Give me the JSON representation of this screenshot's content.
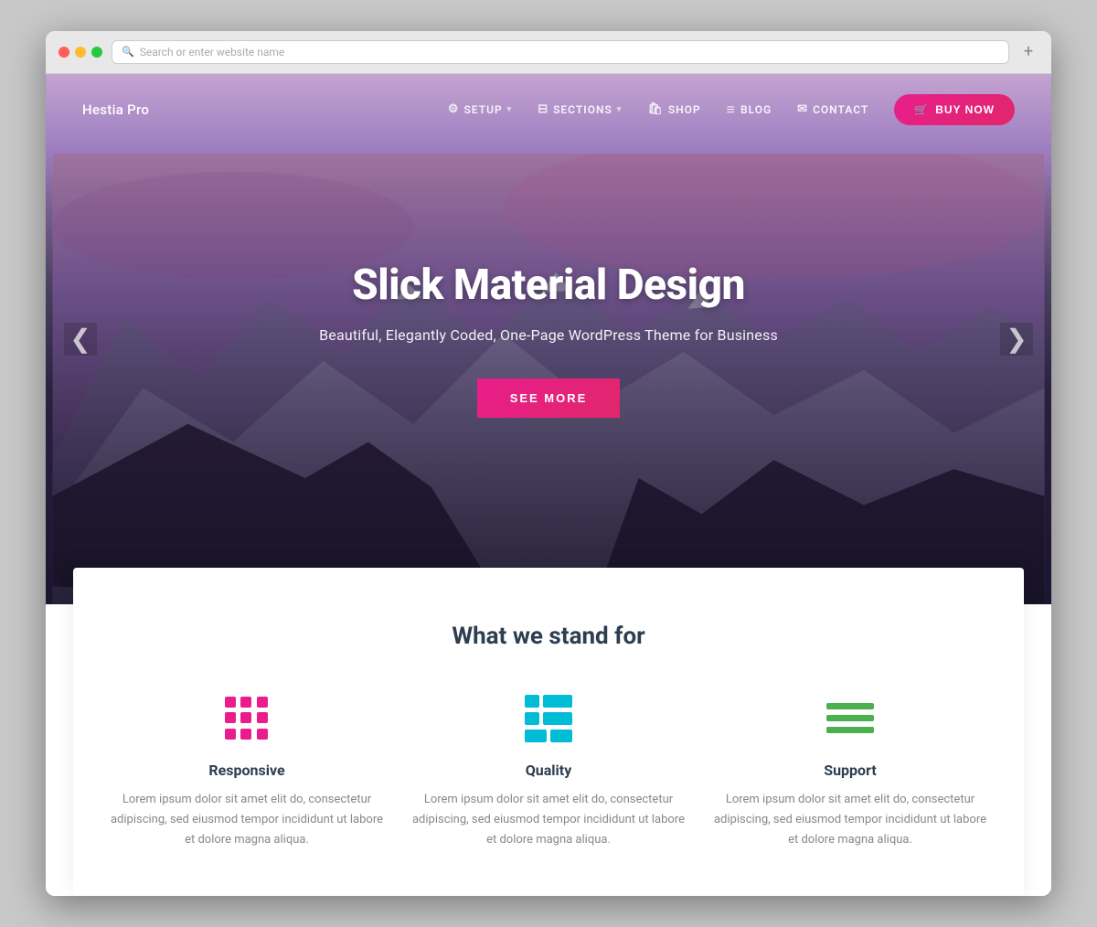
{
  "browser": {
    "address_placeholder": "Search or enter website name",
    "add_tab_label": "+"
  },
  "navbar": {
    "brand": "Hestia Pro",
    "links": [
      {
        "id": "setup",
        "label": "SETUP",
        "icon": "⚙",
        "has_arrow": true
      },
      {
        "id": "sections",
        "label": "SECTIONS",
        "icon": "☰",
        "has_arrow": true
      },
      {
        "id": "shop",
        "label": "SHOP",
        "icon": "🛍"
      },
      {
        "id": "blog",
        "label": "BLOG",
        "icon": "≡"
      },
      {
        "id": "contact",
        "label": "CONTACT",
        "icon": "✉"
      }
    ],
    "buy_button": "BUY NOW",
    "cart_icon": "🛒"
  },
  "hero": {
    "title": "Slick Material Design",
    "subtitle": "Beautiful, Elegantly Coded, One-Page WordPress Theme for Business",
    "cta_button": "SEE MORE",
    "arrow_left": "❮",
    "arrow_right": "❯"
  },
  "features": {
    "section_title": "What we stand for",
    "items": [
      {
        "id": "responsive",
        "name": "Responsive",
        "description": "Lorem ipsum dolor sit amet elit do, consectetur adipiscing, sed eiusmod tempor incididunt ut labore et dolore magna aliqua."
      },
      {
        "id": "quality",
        "name": "Quality",
        "description": "Lorem ipsum dolor sit amet elit do, consectetur adipiscing, sed eiusmod tempor incididunt ut labore et dolore magna aliqua."
      },
      {
        "id": "support",
        "name": "Support",
        "description": "Lorem ipsum dolor sit amet elit do, consectetur adipiscing, sed eiusmod tempor incididunt ut labore et dolore magna aliqua."
      }
    ]
  },
  "colors": {
    "pink": "#e91e8c",
    "cyan": "#00bcd4",
    "green": "#4caf50",
    "dark_text": "#2c3e50",
    "muted_text": "#999999"
  }
}
